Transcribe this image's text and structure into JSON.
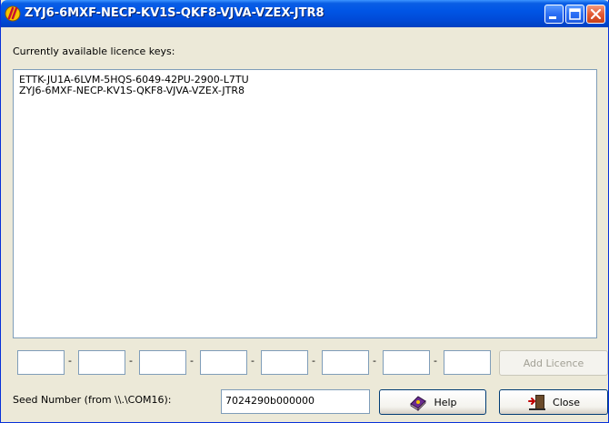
{
  "window": {
    "title": "ZYJ6-6MXF-NECP-KV1S-QKF8-VJVA-VZEX-JTR8",
    "icon": "app-logo-icon",
    "controls": {
      "minimize": "minimize-icon",
      "maximize": "maximize-icon",
      "close": "close-icon"
    }
  },
  "keys": {
    "label": "Currently available licence keys:",
    "items": [
      "ETTK-JU1A-6LVM-5HQS-6049-42PU-2900-L7TU",
      "ZYJ6-6MXF-NECP-KV1S-QKF8-VJVA-VZEX-JTR8"
    ]
  },
  "entry": {
    "segment_values": [
      "",
      "",
      "",
      "",
      "",
      "",
      "",
      ""
    ],
    "separator": "-",
    "add_label": "Add Licence"
  },
  "seed": {
    "label": "Seed Number (from \\\\.\\COM16):",
    "value": "7024290b000000"
  },
  "buttons": {
    "help": {
      "label": "Help",
      "icon": "help-book-icon"
    },
    "close": {
      "label": "Close",
      "icon": "close-door-icon"
    }
  },
  "colors": {
    "titlebar": "#0055e5",
    "window_bg": "#ece9d8",
    "input_border": "#7f9db9",
    "close_button": "#e35b35"
  }
}
